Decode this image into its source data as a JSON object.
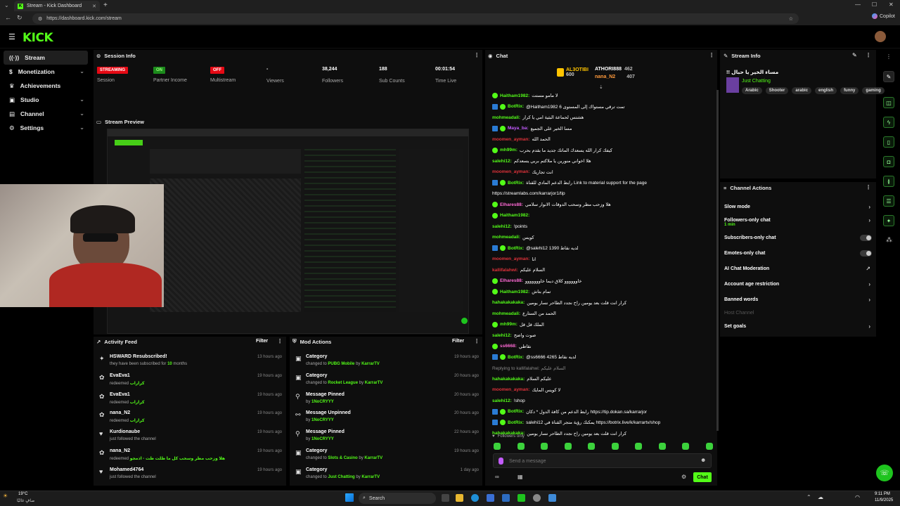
{
  "browser": {
    "tab_title": "Stream - Kick Dashboard",
    "url": "https://dashboard.kick.com/stream",
    "copilot": "Copilot"
  },
  "logo": "KICK",
  "sidebar": {
    "items": [
      {
        "label": "Stream",
        "icon": "broadcast-icon"
      },
      {
        "label": "Monetization",
        "icon": "dollar-icon"
      },
      {
        "label": "Achievements",
        "icon": "trophy-icon"
      },
      {
        "label": "Studio",
        "icon": "studio-icon"
      },
      {
        "label": "Channel",
        "icon": "channel-icon"
      },
      {
        "label": "Settings",
        "icon": "gear-icon"
      }
    ]
  },
  "session": {
    "title": "Session Info",
    "cols": [
      {
        "value": "STREAMING",
        "label": "Session"
      },
      {
        "value": "ON",
        "label": "Partner Income"
      },
      {
        "value": "OFF",
        "label": "Multistream"
      },
      {
        "value": "-",
        "label": "Viewers"
      },
      {
        "value": "38,244",
        "label": "Followers"
      },
      {
        "value": "188",
        "label": "Sub Counts"
      },
      {
        "value": "00:01:54",
        "label": "Time Live"
      }
    ]
  },
  "preview": {
    "title": "Stream Preview"
  },
  "activity": {
    "title": "Activity Feed",
    "filter": "Filter",
    "rows": [
      {
        "t": "HSWARD Resubscribed!",
        "s": "they have been subscribed for",
        "b": "10",
        "s2": "months",
        "time": "13 hours ago"
      },
      {
        "t": "EvaEva1",
        "s": "redeemed",
        "b": "كراراب",
        "time": "19 hours ago"
      },
      {
        "t": "EvaEva1",
        "s": "redeemed",
        "b": "كراراب",
        "time": "19 hours ago"
      },
      {
        "t": "nana_N2",
        "s": "redeemed",
        "b": "كراراب",
        "time": "19 hours ago"
      },
      {
        "t": "Kurdionaube",
        "s": "just followed the channel",
        "b": "",
        "time": "19 hours ago"
      },
      {
        "t": "nana_N2",
        "s": "redeemed",
        "b": "هلا وزحب مطر وسحب كل ما طلت طت - اذمجو",
        "time": "19 hours ago"
      },
      {
        "t": "Mohamed4764",
        "s": "just followed the channel",
        "b": "",
        "time": "19 hours ago"
      }
    ]
  },
  "mod": {
    "title": "Mod Actions",
    "filter": "Filter",
    "rows": [
      {
        "t": "Category",
        "s": "changed to",
        "b": "PUBG Mobile",
        "by": "by",
        "u": "KarrarTV",
        "time": "19 hours ago"
      },
      {
        "t": "Category",
        "s": "changed to",
        "b": "Rocket League",
        "by": "by",
        "u": "KarrarTV",
        "time": "20 hours ago"
      },
      {
        "t": "Message Pinned",
        "s": "by",
        "b": "1NoCRYYY",
        "by": "",
        "u": "",
        "time": "20 hours ago"
      },
      {
        "t": "Message Unpinned",
        "s": "by",
        "b": "1NoCRYYY",
        "by": "",
        "u": "",
        "time": "20 hours ago"
      },
      {
        "t": "Message Pinned",
        "s": "by",
        "b": "1NoCRYYY",
        "by": "",
        "u": "",
        "time": "22 hours ago"
      },
      {
        "t": "Category",
        "s": "changed to",
        "b": "Slots & Casino",
        "by": "by",
        "u": "KarrarTV",
        "time": "19 hours ago"
      },
      {
        "t": "Category",
        "s": "changed to",
        "b": "Just Chatting",
        "by": "by",
        "u": "KarrarTV",
        "time": "1 day ago"
      }
    ]
  },
  "chat": {
    "title": "Chat",
    "top": [
      {
        "name": "AL3OTIBI",
        "count": "600"
      },
      {
        "name": "ATHORI888",
        "count": "462"
      },
      {
        "name": "nana_N2",
        "count": "407"
      }
    ],
    "lines": [
      {
        "u": "Haitham1982:",
        "c": "#53fc18",
        "m": "لا مامو مستت",
        "bot": false,
        "ver": true
      },
      {
        "u": "BotRix:",
        "c": "#53fc18",
        "m": "@Haitham1982 تمت ترقي مستواك إلى المستوى 6",
        "bot": true,
        "ver": true
      },
      {
        "u": "mohmeadali:",
        "c": "#53fc18",
        "m": "هشتس لحماعة البثية امي يا كرار",
        "bot": false,
        "ver": false
      },
      {
        "u": "Maya_ba:",
        "c": "#c45cff",
        "m": "مسا الخير على الجميع",
        "bot": true,
        "ver": true
      },
      {
        "u": "moomen_ayman:",
        "c": "#e0323a",
        "m": "الحمد الله",
        "bot": false,
        "ver": false
      },
      {
        "u": "mh99m:",
        "c": "#53fc18",
        "m": "كيفك كرار الله يسعدك الماتك جديد ما بقدم بحرب",
        "bot": false,
        "ver": true
      },
      {
        "u": "salehi12:",
        "c": "#53fc18",
        "m": "هلا اخواني منورين يا ملاكتم بربي يسعدكم",
        "bot": false,
        "ver": false
      },
      {
        "u": "moomen_ayman:",
        "c": "#e0323a",
        "m": "انت تجاريك",
        "bot": false,
        "ver": false
      },
      {
        "u": "BotRix:",
        "c": "#53fc18",
        "m": "رابط الدعم المادي للقناة Link to material support for the page",
        "bot": true,
        "ver": true
      },
      {
        "u": "",
        "c": "#fff",
        "m": "https://streamlabs.com/karrarjor1/tip",
        "bot": false,
        "ver": false
      },
      {
        "u": "Elhares88:",
        "c": "#ff6ad5",
        "m": "هلا وزحب مطر وسحب الدوقات الانوار سلامي",
        "bot": false,
        "ver": true
      },
      {
        "u": "Haitham1982:",
        "c": "#53fc18",
        "m": "",
        "bot": false,
        "ver": true
      },
      {
        "u": "salehi12:",
        "c": "#53fc18",
        "m": "!points",
        "bot": false,
        "ver": false
      },
      {
        "u": "mohmeadali:",
        "c": "#53fc18",
        "m": "كويس",
        "bot": false,
        "ver": false
      },
      {
        "u": "BotRix:",
        "c": "#53fc18",
        "m": "@salehi12 1390 لديه نقاط",
        "bot": true,
        "ver": true
      },
      {
        "u": "moomen_ayman:",
        "c": "#e0323a",
        "m": "انا",
        "bot": false,
        "ver": false
      },
      {
        "u": "kallifalahwi:",
        "c": "#e0323a",
        "m": "السلام عليكم",
        "bot": false,
        "ver": false
      },
      {
        "u": "Elhares88:",
        "c": "#ff6ad5",
        "m": "خاوووووو كلاق ديما خاووووووو",
        "bot": false,
        "ver": true
      },
      {
        "u": "Haitham1982:",
        "c": "#53fc18",
        "m": "تمام بتاش",
        "bot": false,
        "ver": true
      },
      {
        "u": "hahakakakaka:",
        "c": "#53fc18",
        "m": "كرار انت قلت بعد يومين راح نجدد الطاحر نسار يومين",
        "bot": false,
        "ver": false
      },
      {
        "u": "mohmeadali:",
        "c": "#53fc18",
        "m": "الحمد من الستارع",
        "bot": false,
        "ver": false
      },
      {
        "u": "mh99m:",
        "c": "#53fc18",
        "m": "الملك قل قل",
        "bot": false,
        "ver": true
      },
      {
        "u": "salehi12:",
        "c": "#53fc18",
        "m": "صوت واضح",
        "bot": false,
        "ver": false
      },
      {
        "u": "ss6668:",
        "c": "#ff6ad5",
        "m": "نقاطي",
        "bot": false,
        "ver": true
      },
      {
        "u": "BotRix:",
        "c": "#53fc18",
        "m": "@ss6666 4265 لديه نقاط",
        "bot": true,
        "ver": true
      },
      {
        "u": "",
        "c": "#888",
        "m": "Replying to kallifalahwi: السلام عليكم",
        "bot": false,
        "ver": false
      },
      {
        "u": "hahakakakaka:",
        "c": "#53fc18",
        "m": "عليكم السلام",
        "bot": false,
        "ver": false
      },
      {
        "u": "moomen_ayman:",
        "c": "#e0323a",
        "m": "لا كويس المايك",
        "bot": false,
        "ver": false
      },
      {
        "u": "salehi12:",
        "c": "#53fc18",
        "m": "!shop",
        "bot": false,
        "ver": false
      },
      {
        "u": "BotRix:",
        "c": "#53fc18",
        "m": "رابط الدعم من كافة الدول * دكان https://tip.dokan.sa/karrarjor",
        "bot": true,
        "ver": true
      },
      {
        "u": "BotRix:",
        "c": "#53fc18",
        "m": "salehi12 يمكنك رؤية متجر القناة في https://botrix.live/k/karrartv/shop",
        "bot": true,
        "ver": true
      },
      {
        "u": "hahakakakaka:",
        "c": "#53fc18",
        "m": "كرار انت قلت بعد يومين راح نجدد الطاحر نسار يومين",
        "bot": false,
        "ver": false
      }
    ],
    "followers_only": "Followers only",
    "placeholder": "Send a message",
    "send": "Chat"
  },
  "streaminfo": {
    "title": "Stream Info",
    "stream_title": "!! مساء الخير يا حبال",
    "category": "Just Chatting",
    "tags": [
      "Arabic",
      "Shooter",
      "arabic",
      "english",
      "funny",
      "gaming"
    ]
  },
  "channel_actions": {
    "title": "Channel Actions",
    "items": [
      {
        "label": "Slow mode",
        "kind": "chev",
        "sub": ""
      },
      {
        "label": "Followers-only chat",
        "kind": "chev",
        "sub": "1 min"
      },
      {
        "label": "Subscribers-only chat",
        "kind": "toggle",
        "sub": ""
      },
      {
        "label": "Emotes-only chat",
        "kind": "toggle",
        "sub": ""
      },
      {
        "label": "AI Chat Moderation",
        "kind": "ext",
        "sub": ""
      },
      {
        "label": "Account age restriction",
        "kind": "chev",
        "sub": ""
      },
      {
        "label": "Banned words",
        "kind": "chev",
        "sub": ""
      },
      {
        "label": "Host Channel",
        "kind": "none",
        "sub": ""
      },
      {
        "label": "Set goals",
        "kind": "chev",
        "sub": ""
      }
    ]
  },
  "taskbar": {
    "weather": "19°C",
    "weather_sub": "صافٍ غالبًا",
    "search": "Search",
    "time": "9:11 PM",
    "date": "11/9/2025"
  }
}
